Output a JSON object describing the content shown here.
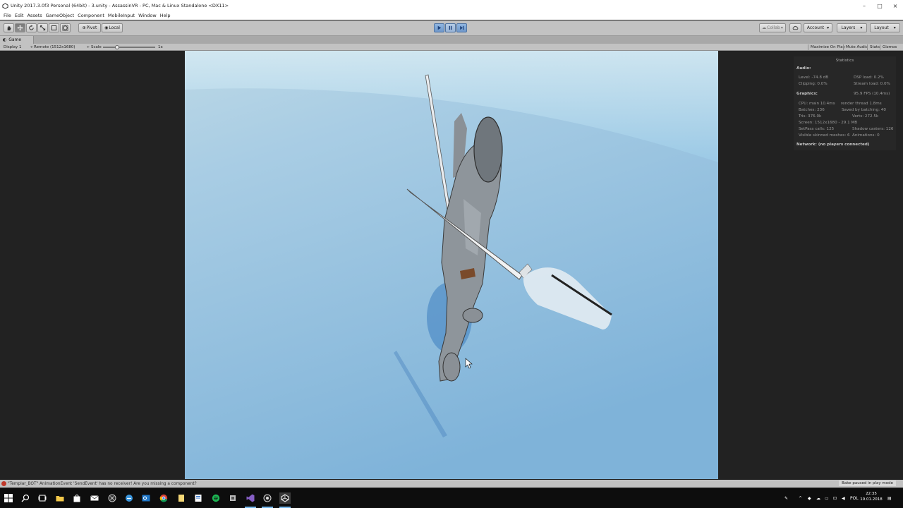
{
  "window": {
    "title": "Unity 2017.3.0f3 Personal (64bit) - 3.unity - AssassinVR - PC, Mac & Linux Standalone <DX11>",
    "controls": [
      "–",
      "□",
      "×"
    ]
  },
  "menu": [
    "File",
    "Edit",
    "Assets",
    "GameObject",
    "Component",
    "MobileInput",
    "Window",
    "Help"
  ],
  "toolbar": {
    "tools": [
      "hand-icon",
      "move-icon",
      "rotate-icon",
      "scale-icon",
      "rect-icon",
      "transform-icon"
    ],
    "pivot_label": "Pivot",
    "local_label": "Local",
    "collab_label": "Collab",
    "account_label": "Account",
    "layers_label": "Layers",
    "layout_label": "Layout",
    "caret": "▾"
  },
  "game_tab": {
    "label": "Game",
    "display": "Display 1",
    "resolution": "Remote (1512x1680)",
    "scale_label": "Scale",
    "scale_value": "1x",
    "maximize": "Maximize On Play",
    "mute": "Mute Audio",
    "stats": "Stats",
    "gizmos": "Gizmos"
  },
  "statistics": {
    "header": "Statistics",
    "audio_label": "Audio:",
    "level": "Level: -74.8 dB",
    "clipping": "Clipping: 0.0%",
    "dsp": "DSP load: 0.2%",
    "stream": "Stream load: 0.0%",
    "graphics_label": "Graphics:",
    "fps": "95.9 FPS (10.4ms)",
    "cpu": "CPU: main 10.4ms",
    "render": "render thread 1.8ms",
    "batches": "Batches: 236",
    "saved": "Saved by batching: 40",
    "tris": "Tris: 376.0k",
    "verts": "Verts: 272.5k",
    "screen": "Screen: 1512x1680 - 29.1 MB",
    "setpass": "SetPass calls: 125",
    "shadow": "Shadow casters: 126",
    "skinned": "Visible skinned meshes: 6",
    "animations": "Animations: 0",
    "network": "Network: (no players connected)"
  },
  "console": {
    "message": "\"Templar_BOT\" AnimationEvent 'SendEvent' has no receiver! Are you missing a component?",
    "right_status": "Bake paused in play mode"
  },
  "taskbar": {
    "apps": [
      "windows-icon",
      "search-icon",
      "task-view-icon",
      "file-explorer-icon",
      "store-icon",
      "mail-icon",
      "xbox-icon",
      "edge-icon",
      "outlook-icon",
      "chrome-icon",
      "notes-icon",
      "files-icon",
      "spotify-icon",
      "tool-icon",
      "visual-studio-icon",
      "unity-hub-icon",
      "unity-icon"
    ],
    "language": "POL",
    "time": "22:35",
    "date": "19.01.2018"
  }
}
